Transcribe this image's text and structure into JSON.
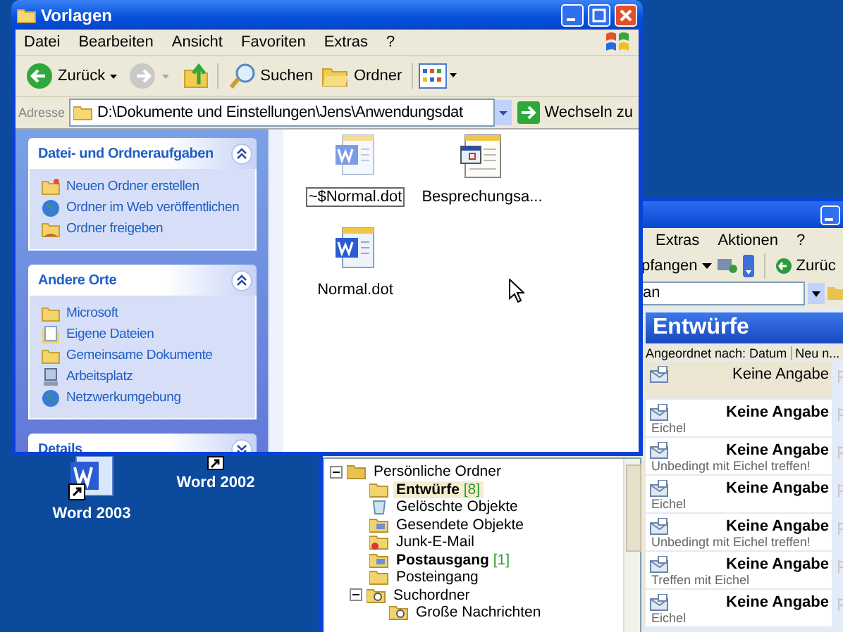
{
  "desktop_icons": [
    {
      "label": "Word 2003"
    },
    {
      "label": "Word 2002"
    }
  ],
  "outlook": {
    "menu": [
      "Extras",
      "Aktionen",
      "?"
    ],
    "toolbar": {
      "receive": "pfangen",
      "back": "Zurüc"
    },
    "field": {
      "value": "an"
    },
    "folder_title": "Entwürfe",
    "sort": {
      "label": "Angeordnet nach: Datum",
      "order": "Neu n..."
    },
    "messages": [
      {
        "from": "Keine Angabe",
        "unread": false,
        "selected": true
      },
      {
        "from": "Keine Angabe",
        "subject": "Eichel",
        "unread": true,
        "selected": false
      },
      {
        "from": "Keine Angabe",
        "subject": "Unbedingt mit Eichel treffen!",
        "unread": true,
        "selected": false
      },
      {
        "from": "Keine Angabe",
        "subject": "Eichel",
        "unread": true,
        "selected": false
      },
      {
        "from": "Keine Angabe",
        "subject": "Unbedingt mit Eichel treffen!",
        "unread": true,
        "selected": false
      },
      {
        "from": "Keine Angabe",
        "subject": "Treffen mit Eichel",
        "unread": true,
        "selected": false
      },
      {
        "from": "Keine Angabe",
        "subject": "Eichel",
        "unread": true,
        "selected": false
      }
    ],
    "folders": [
      {
        "name": "Persönliche Ordner",
        "kind": "personal",
        "expanded": true,
        "selected": false,
        "children": [
          {
            "name": "Entwürfe",
            "count": "[8]",
            "kind": "drafts",
            "selected": true
          },
          {
            "name": "Gelöschte Objekte",
            "kind": "trash",
            "selected": false
          },
          {
            "name": "Gesendete Objekte",
            "kind": "sent",
            "selected": false
          },
          {
            "name": "Junk-E-Mail",
            "kind": "junk",
            "selected": false
          },
          {
            "name": "Postausgang",
            "count": "[1]",
            "kind": "outbox",
            "selected": false
          },
          {
            "name": "Posteingang",
            "kind": "inbox",
            "selected": false
          },
          {
            "name": "Suchordner",
            "kind": "search",
            "expanded": true,
            "selected": false,
            "children": [
              {
                "name": "Große Nachrichten",
                "kind": "search",
                "selected": false
              }
            ]
          }
        ]
      }
    ]
  },
  "explorer": {
    "title": "Vorlagen",
    "menu": [
      "Datei",
      "Bearbeiten",
      "Ansicht",
      "Favoriten",
      "Extras",
      "?"
    ],
    "toolbar": {
      "back": "Zurück",
      "search": "Suchen",
      "folders": "Ordner"
    },
    "address": {
      "label": "Adresse",
      "value": "D:\\Dokumente und Einstellungen\\Jens\\Anwendungsdat",
      "go": "Wechseln zu"
    },
    "task_panels": [
      {
        "title": "Datei- und Ordneraufgaben",
        "expanded": true,
        "items": [
          {
            "label": "Neuen Ordner erstellen",
            "kind": "new-folder"
          },
          {
            "label": "Ordner im Web veröffentlichen",
            "kind": "web"
          },
          {
            "label": "Ordner freigeben",
            "kind": "share"
          }
        ]
      },
      {
        "title": "Andere Orte",
        "expanded": true,
        "items": [
          {
            "label": "Microsoft",
            "kind": "folder"
          },
          {
            "label": "Eigene Dateien",
            "kind": "documents"
          },
          {
            "label": "Gemeinsame Dokumente",
            "kind": "folder"
          },
          {
            "label": "Arbeitsplatz",
            "kind": "computer"
          },
          {
            "label": "Netzwerkumgebung",
            "kind": "network"
          }
        ]
      },
      {
        "title": "Details",
        "expanded": false
      }
    ],
    "files": [
      {
        "name": "~$Normal.dot",
        "kind": "document",
        "selected": true
      },
      {
        "name": "Besprechungsa...",
        "kind": "calendar",
        "selected": false
      },
      {
        "name": "Normal.dot",
        "kind": "document",
        "selected": false
      }
    ]
  }
}
